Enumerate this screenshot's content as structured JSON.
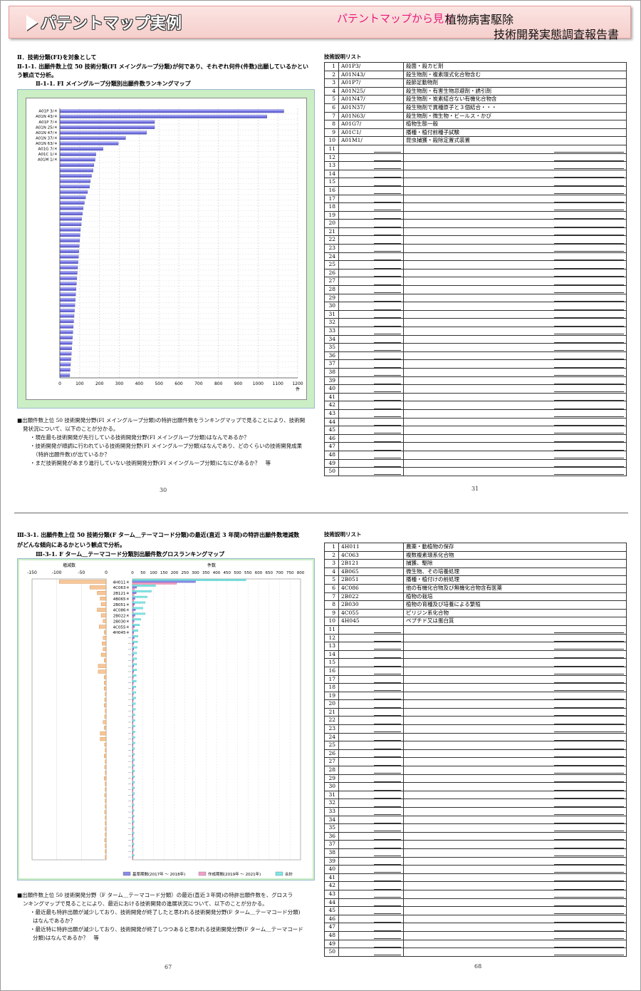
{
  "header": {
    "title": "パテントマップ実例",
    "pink": "パテントマップから見た",
    "subtitle1": "植物病害駆除",
    "subtitle2": "技術開発実態調査報告書"
  },
  "page1": {
    "h1": "Ⅱ．技術分類(FI)を対象として",
    "h2a": "Ⅱ-1-1. 出願件数上位 50 技術分類(FI メイングループ分類)が何であり、それぞれ何件(件数)出願しているかとい",
    "h2b": "う観点で分析。",
    "h3": "Ⅱ-1-1. FI メイングループ分類別出願件数ランキングマップ",
    "table_title": "技術説明リスト",
    "lines": [
      "■出願件数上位 50 技術開発分野(FI メイングループ分類)の特許出願件数をランキングマップで見ることにより、技術開",
      "発状況について、以下のことが分かる。",
      "・現在最も技術開発が先行している技術開発分野(FI メイングループ分類)はなんであるか？",
      "・技術開発が順調に行われている技術開発分野(FI メイングループ分類)はなんであり、どのくらいの技術開発成果",
      "（特許出願件数)が出ているか？",
      "・まだ技術開発があまり進行していない技術開発分野(FI メイングループ分類)になにがあるか？　等"
    ],
    "page_left": "30",
    "page_right": "31",
    "rows": [
      [
        "A01P3/",
        "殺菌・殺カビ剤"
      ],
      [
        "A01N43/",
        "殺生物剤・複素環式化合物含む"
      ],
      [
        "A01P7/",
        "殺節足動物剤"
      ],
      [
        "A01N25/",
        "殺生物剤・有害生物忌避剤・誘引剤"
      ],
      [
        "A01N47/",
        "殺生物剤・炭素結合ない有機化合物含"
      ],
      [
        "A01N37/",
        "殺生物剤で異種原子と３個結合・・・"
      ],
      [
        "A01N63/",
        "殺生物剤・微生物・ビールス・かび"
      ],
      [
        "A01G7/",
        "植物生態一般"
      ],
      [
        "A01C1/",
        "播種・植付前種子試験"
      ],
      [
        "A01M1/",
        "昆虫捕獲・殺除定置式装置"
      ]
    ]
  },
  "page2": {
    "h1": "Ⅲ-3-1. 出願件数上位 50 技術分類(F ターム＿テーマコード分類)の最近(直近 3 年間)の特許出願件数増減数",
    "h2": "がどんな傾向にあるかという観点で分析。",
    "h3": "Ⅲ-3-1. F ターム＿テーマコード分類別出願件数グロスランキングマップ",
    "table_title": "技術説明リスト",
    "lines": [
      "■出願件数上位 50 技術開発分野（F ターム＿テーマコード分類）の最近(直近３年間)の特許出願件数を、グロスラ",
      "ンキングマップで見ることにより、最近における技術開発の進展状況について、以下のことが分かる。",
      "・最近最も特許出願が減少しており、技術開発が終了したと思われる技術開発分野(F ターム＿テーマコード分類)",
      "はなんであるか？",
      "・最近特に特許出願が減少しており、技術開発が終了しつつあると思われる技術開発分野(F ターム＿テーマコード",
      "分類)はなんであるか？　等"
    ],
    "page_left": "67",
    "page_right": "68",
    "rows": [
      [
        "4H011",
        "農薬・動植物の保存"
      ],
      [
        "4C063",
        "複数複素環系化合物"
      ],
      [
        "2B121",
        "捕獲、駆除"
      ],
      [
        "4B065",
        "微生物、その培養処理"
      ],
      [
        "2B051",
        "播種・植付けの前処理"
      ],
      [
        "4C086",
        "他の有機化合物及び無機化合物含有医薬"
      ],
      [
        "2B022",
        "植物の栽培"
      ],
      [
        "2B030",
        "植物の育種及び培養による繁殖"
      ],
      [
        "4C055",
        "ピリジン系化合物"
      ],
      [
        "4H045",
        "ペプチド又は蛋白質"
      ]
    ],
    "legend": [
      "基準期間(2017年 ～ 2018年)",
      "作成期間(2019年 ～ 2021年)",
      "合計"
    ]
  },
  "chart_data": [
    {
      "type": "bar",
      "orientation": "horizontal",
      "title": "",
      "labels": [
        "A01P 3/＊",
        "A01N 43/＊",
        "A01P 7/＊",
        "A01N 25/＊",
        "A01N 47/＊",
        "A01N 37/＊",
        "A01N 63/＊",
        "A01G 7/＊",
        "A01C 1/＊",
        "A01M 1/＊"
      ],
      "values": [
        1130,
        1045,
        478,
        478,
        438,
        332,
        295,
        218,
        182,
        178,
        172,
        168,
        160,
        154,
        150,
        140,
        130,
        124,
        118,
        114,
        110,
        108,
        104,
        102,
        100,
        98,
        96,
        94,
        92,
        90,
        88,
        86,
        84,
        82,
        80,
        78,
        76,
        74,
        72,
        70,
        68,
        66,
        64,
        62,
        60,
        58,
        56,
        54,
        52,
        50
      ],
      "xticks": [
        0,
        100,
        200,
        300,
        400,
        500,
        600,
        700,
        800,
        900,
        1000,
        1100,
        1200
      ],
      "xunit": "件",
      "xlim": [
        0,
        1200
      ]
    },
    {
      "type": "bar",
      "orientation": "horizontal",
      "title": "",
      "labels": [
        "4H011＊",
        "4C063＊",
        "2B121＊",
        "4B065＊",
        "2B051＊",
        "4C086＊",
        "2B022＊",
        "2B030＊",
        "4C055＊",
        "4H045＊"
      ],
      "left_title": "増減数",
      "left_xticks": [
        -150,
        -100,
        -50,
        0
      ],
      "right_title": "件数",
      "right_xticks": [
        0,
        50,
        100,
        150,
        200,
        250,
        300,
        350,
        400,
        450,
        500,
        550,
        600,
        650,
        700,
        750,
        800
      ],
      "diff": [
        -95,
        -33,
        -18,
        -12,
        -10,
        -18,
        -10,
        -6,
        -14,
        -4,
        -6,
        -8,
        -6,
        -10,
        -4,
        -16,
        -16,
        -4,
        -4,
        -4,
        -2,
        -3,
        -4,
        -2,
        -3,
        -6,
        -4,
        -12,
        -12,
        -3,
        -2,
        -4,
        -2,
        -3,
        -2,
        -4,
        -2,
        -2,
        -3,
        -2,
        -2,
        -3,
        -2,
        -2,
        -2,
        -2,
        -3,
        -2,
        -2,
        -2
      ],
      "series": [
        {
          "name": "基準期間(2017年 ～ 2018年)",
          "values": [
            300,
            20,
            18,
            12,
            10,
            14,
            12,
            8,
            10,
            6,
            8,
            6,
            6,
            5,
            5,
            6,
            6,
            4,
            4,
            4,
            4,
            4,
            3,
            3,
            3,
            3,
            3,
            3,
            3,
            3,
            3,
            3,
            3,
            3,
            3,
            3,
            3,
            3,
            3,
            3,
            3,
            3,
            3,
            3,
            3,
            3,
            3,
            3,
            3,
            3
          ]
        },
        {
          "name": "作成期間(2019年 ～ 2021年)",
          "values": [
            210,
            10,
            8,
            6,
            6,
            4,
            6,
            4,
            4,
            4,
            3,
            3,
            3,
            3,
            3,
            3,
            3,
            3,
            3,
            3,
            3,
            3,
            3,
            3,
            3,
            3,
            3,
            3,
            3,
            3,
            3,
            3,
            3,
            3,
            3,
            3,
            3,
            3,
            3,
            3,
            3,
            3,
            3,
            3,
            3,
            3,
            3,
            3,
            3,
            3
          ]
        },
        {
          "name": "合計",
          "values": [
            540,
            110,
            90,
            70,
            60,
            50,
            60,
            40,
            34,
            26,
            26,
            24,
            22,
            20,
            20,
            20,
            20,
            18,
            18,
            16,
            16,
            16,
            14,
            14,
            12,
            12,
            12,
            12,
            12,
            12,
            10,
            10,
            10,
            10,
            10,
            10,
            10,
            10,
            10,
            10,
            8,
            8,
            8,
            8,
            8,
            8,
            8,
            8,
            8,
            8
          ]
        }
      ],
      "legend_position": "bottom-right"
    }
  ]
}
